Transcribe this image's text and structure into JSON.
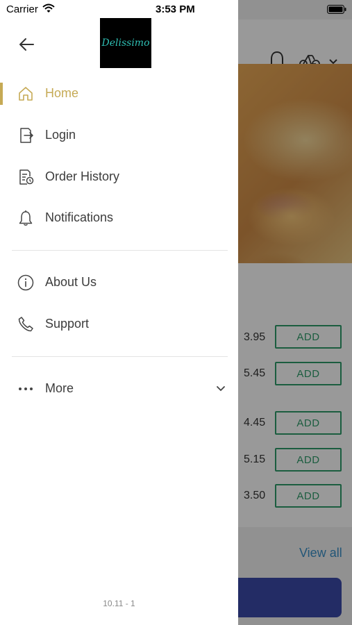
{
  "status_bar": {
    "carrier": "Carrier",
    "time": "3:53 PM"
  },
  "drawer": {
    "logo_text": "Delissimo",
    "menu_primary": [
      {
        "label": "Home",
        "icon": "home-icon",
        "active": true
      },
      {
        "label": "Login",
        "icon": "login-icon",
        "active": false
      },
      {
        "label": "Order History",
        "icon": "order-history-icon",
        "active": false
      },
      {
        "label": "Notifications",
        "icon": "bell-icon",
        "active": false
      }
    ],
    "menu_secondary": [
      {
        "label": "About Us",
        "icon": "info-icon"
      },
      {
        "label": "Support",
        "icon": "phone-icon"
      }
    ],
    "more_label": "More",
    "version": "10.11 - 1"
  },
  "background": {
    "items": [
      {
        "price": "3.95",
        "add_label": "ADD"
      },
      {
        "price": "5.45",
        "add_label": "ADD"
      },
      {
        "price": "4.45",
        "add_label": "ADD"
      },
      {
        "price": "5.15",
        "add_label": "ADD"
      },
      {
        "price": "3.50",
        "add_label": "ADD"
      }
    ],
    "view_all": "View all"
  },
  "colors": {
    "accent": "#c6aa55",
    "add_button": "#2e9b6a",
    "link": "#3a8fc7",
    "primary_button": "#3b4aa8",
    "overlay": "rgba(0,0,0,0.4)"
  }
}
